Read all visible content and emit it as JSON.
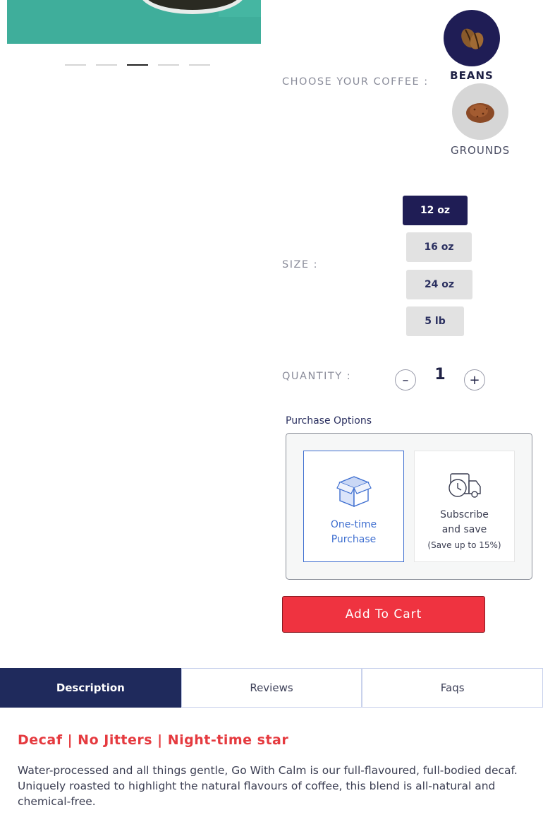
{
  "carousel": {
    "slide_count": 5,
    "active_index": 2,
    "dots": [
      "dot-1",
      "dot-2",
      "dot-3",
      "dot-4",
      "dot-5"
    ]
  },
  "coffee": {
    "label": "CHOOSE YOUR COFFEE :",
    "options": [
      {
        "name": "BEANS",
        "icon": "coffee-bean-icon",
        "selected": true
      },
      {
        "name": "GROUNDS",
        "icon": "ground-coffee-icon",
        "selected": false
      }
    ]
  },
  "size": {
    "label": "SIZE :",
    "options": [
      "12 oz",
      "16 oz",
      "24 oz",
      "5 lb"
    ],
    "selected": "12 oz"
  },
  "quantity": {
    "label": "QUANTITY :",
    "minus": "–",
    "value": "1",
    "plus": "+"
  },
  "purchase_options": {
    "title": "Purchase Options",
    "one_time": {
      "line1": "One-time",
      "line2": "Purchase",
      "icon": "box-icon",
      "selected": true
    },
    "subscribe": {
      "line1": "Subscribe",
      "line2": "and save",
      "note": "(Save up to 15%)",
      "icon": "delivery-truck-clock-icon",
      "selected": false
    }
  },
  "cart": {
    "label": "Add To Cart"
  },
  "tabs": [
    {
      "label": "Description",
      "active": true
    },
    {
      "label": "Reviews",
      "active": false
    },
    {
      "label": "Faqs",
      "active": false
    }
  ],
  "description": {
    "heading": "Decaf | No Jitters | Night-time star",
    "body": "Water-processed and all things gentle, Go With Calm is our full-flavoured, full-bodied decaf. Uniquely roasted to highlight the natural flavours of coffee, this blend is all-natural and chemical-free."
  },
  "colors": {
    "accent_navy": "#1f1d55",
    "tab_navy": "#1f2a5c",
    "cart_red": "#ef3340",
    "heading_red": "#e53a3f",
    "selected_blue": "#3f6fd0",
    "image_teal": "#3fae9b"
  }
}
